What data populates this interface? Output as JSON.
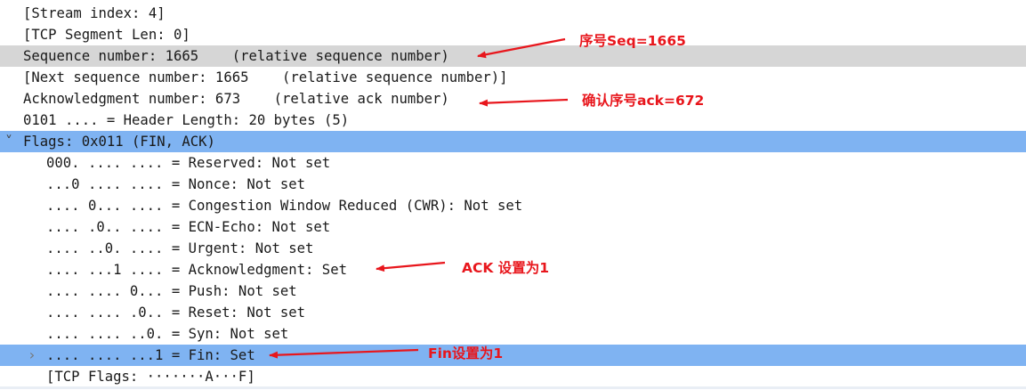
{
  "packet_tree": {
    "rows": [
      {
        "text": "[Stream index: 4]",
        "indent": 0,
        "highlight": "none",
        "twisty": ""
      },
      {
        "text": "[TCP Segment Len: 0]",
        "indent": 0,
        "highlight": "none",
        "twisty": ""
      },
      {
        "text": "Sequence number: 1665    (relative sequence number)",
        "indent": 0,
        "highlight": "gray",
        "twisty": ""
      },
      {
        "text": "[Next sequence number: 1665    (relative sequence number)]",
        "indent": 0,
        "highlight": "none",
        "twisty": ""
      },
      {
        "text": "Acknowledgment number: 673    (relative ack number)",
        "indent": 0,
        "highlight": "none",
        "twisty": ""
      },
      {
        "text": "0101 .... = Header Length: 20 bytes (5)",
        "indent": 0,
        "highlight": "none",
        "twisty": ""
      },
      {
        "text": "Flags: 0x011 (FIN, ACK)",
        "indent": 0,
        "highlight": "blue",
        "twisty": "expanded"
      },
      {
        "text": "000. .... .... = Reserved: Not set",
        "indent": 1,
        "highlight": "none",
        "twisty": ""
      },
      {
        "text": "...0 .... .... = Nonce: Not set",
        "indent": 1,
        "highlight": "none",
        "twisty": ""
      },
      {
        "text": ".... 0... .... = Congestion Window Reduced (CWR): Not set",
        "indent": 1,
        "highlight": "none",
        "twisty": ""
      },
      {
        "text": ".... .0.. .... = ECN-Echo: Not set",
        "indent": 1,
        "highlight": "none",
        "twisty": ""
      },
      {
        "text": ".... ..0. .... = Urgent: Not set",
        "indent": 1,
        "highlight": "none",
        "twisty": ""
      },
      {
        "text": ".... ...1 .... = Acknowledgment: Set",
        "indent": 1,
        "highlight": "none",
        "twisty": ""
      },
      {
        "text": ".... .... 0... = Push: Not set",
        "indent": 1,
        "highlight": "none",
        "twisty": ""
      },
      {
        "text": ".... .... .0.. = Reset: Not set",
        "indent": 1,
        "highlight": "none",
        "twisty": ""
      },
      {
        "text": ".... .... ..0. = Syn: Not set",
        "indent": 1,
        "highlight": "none",
        "twisty": ""
      },
      {
        "text": ".... .... ...1 = Fin: Set",
        "indent": 1,
        "highlight": "blue",
        "twisty": "collapsed"
      },
      {
        "text": "[TCP Flags: ·······A···F]",
        "indent": 1,
        "highlight": "none",
        "twisty": ""
      }
    ]
  },
  "annotations": {
    "seq": "序号Seq=1665",
    "ack_num": "确认序号ack=672",
    "ack_flag": "ACK 设置为1",
    "fin_flag": "Fin设置为1"
  },
  "colors": {
    "annotation_red": "#e8161c",
    "highlight_blue": "#7fb3f2",
    "highlight_gray": "#d6d6d6"
  },
  "icons": {
    "expanded": "chevron-down-icon",
    "collapsed": "chevron-right-icon"
  }
}
